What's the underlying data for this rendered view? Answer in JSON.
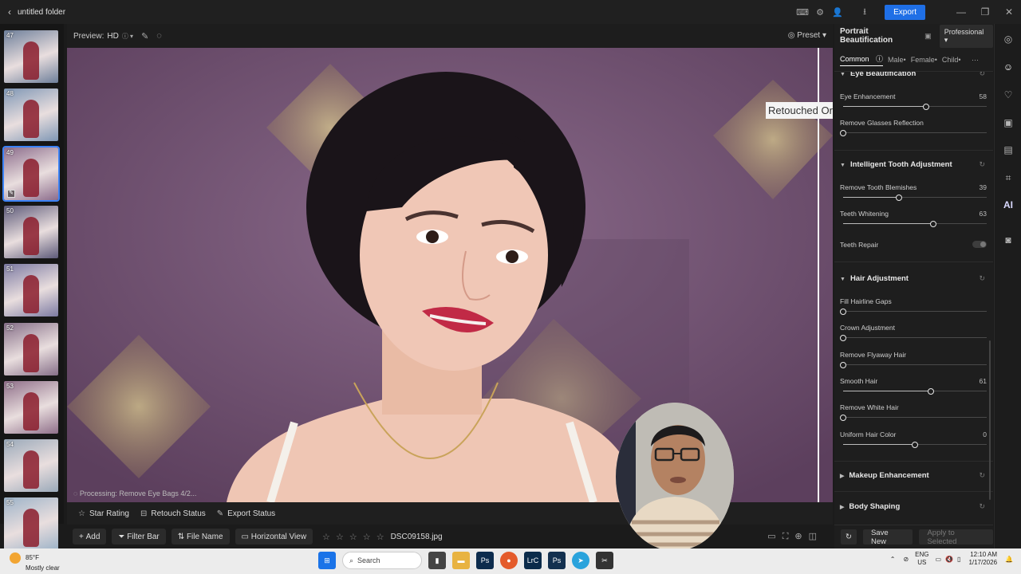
{
  "window": {
    "back_glyph": "‹",
    "title": "untitled folder",
    "export_label": "Export",
    "minimize": "—",
    "maximize": "❐",
    "close": "✕"
  },
  "filmstrip": {
    "thumbs": [
      {
        "num": "47",
        "color": "#6e7f9a"
      },
      {
        "num": "48",
        "color": "#7f97b5"
      },
      {
        "num": "49",
        "color": "#8c6d8c",
        "selected": true
      },
      {
        "num": "50",
        "color": "#5d5a79"
      },
      {
        "num": "51",
        "color": "#7c7aa2"
      },
      {
        "num": "52",
        "color": "#866f88"
      },
      {
        "num": "53",
        "color": "#8f6f89"
      },
      {
        "num": "54",
        "color": "#9aa9b9"
      },
      {
        "num": "55",
        "color": "#9db3c8"
      }
    ]
  },
  "preview": {
    "label": "Preview:",
    "quality": "HD",
    "preset_label": "Preset",
    "retouched_label": "Retouched Or",
    "processing_text": "Processing: Remove Eye Bags 4/2..."
  },
  "bottombar": {
    "star_rating": "Star Rating",
    "retouch_status": "Retouch Status",
    "export_status": "Export Status",
    "add": "Add",
    "filter_bar": "Filter Bar",
    "file_name": "File Name",
    "horizontal_view": "Horizontal View",
    "stars": "☆ ☆ ☆ ☆ ☆",
    "current_file": "DSC09158.jpg"
  },
  "panel": {
    "title": "Portrait Beautification",
    "mode": "Professional",
    "tabs": {
      "common": "Common",
      "male": "Male•",
      "female": "Female•",
      "child": "Child•",
      "more": "···"
    },
    "eye_section": "Eye Beautification",
    "eye_enhancement": {
      "label": "Eye Enhancement",
      "value": "58",
      "pct": 58
    },
    "remove_glasses": {
      "label": "Remove Glasses Reflection",
      "pct": 0
    },
    "tooth_section": "Intelligent Tooth Adjustment",
    "remove_tooth": {
      "label": "Remove Tooth Blemishes",
      "value": "39",
      "pct": 39
    },
    "teeth_whitening": {
      "label": "Teeth Whitening",
      "value": "63",
      "pct": 63
    },
    "teeth_repair": "Teeth Repair",
    "hair_section": "Hair Adjustment",
    "fill_hairline": {
      "label": "Fill Hairline Gaps",
      "pct": 0
    },
    "crown": {
      "label": "Crown Adjustment",
      "pct": 0
    },
    "flyaway": {
      "label": "Remove Flyaway Hair",
      "pct": 0
    },
    "smooth_hair": {
      "label": "Smooth Hair",
      "value": "61",
      "pct": 61
    },
    "white_hair": {
      "label": "Remove White Hair",
      "pct": 0
    },
    "uniform_color": {
      "label": "Uniform Hair Color",
      "value": "0",
      "pct": 50
    },
    "makeup_section": "Makeup Enhancement",
    "body_section": "Body Shaping",
    "save_new": "Save New",
    "apply_selected": "Apply to Selected"
  },
  "rstrip": {
    "ai_label": "AI"
  },
  "taskbar": {
    "temp": "85°F",
    "weather": "Mostly clear",
    "search": "Search",
    "lang1": "ENG",
    "lang2": "US",
    "time": "12:10 AM",
    "date": "1/17/2026",
    "lrc": "LrC",
    "ps": "Ps"
  }
}
